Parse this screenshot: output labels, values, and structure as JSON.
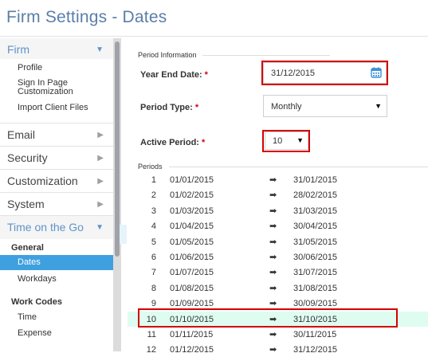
{
  "header": {
    "title": "Firm Settings - Dates"
  },
  "sidebar": {
    "firm": {
      "label": "Firm",
      "items": [
        "Profile",
        "Sign In Page Customization",
        "Import Client Files"
      ]
    },
    "sections": [
      {
        "label": "Email"
      },
      {
        "label": "Security"
      },
      {
        "label": "Customization"
      },
      {
        "label": "System"
      }
    ],
    "time_on_the_go": {
      "label": "Time on the Go",
      "general_heading": "General",
      "general_items": [
        "Dates",
        "Workdays"
      ],
      "active_item": "Dates",
      "work_codes_heading": "Work Codes",
      "work_code_items": [
        "Time",
        "Expense"
      ]
    }
  },
  "main": {
    "period_information_legend": "Period Information",
    "year_end_date": {
      "label": "Year End Date:",
      "required": "*",
      "value": "31/12/2015"
    },
    "period_type": {
      "label": "Period Type:",
      "required": "*",
      "value": "Monthly"
    },
    "active_period": {
      "label": "Active Period:",
      "required": "*",
      "value": "10"
    },
    "periods_legend": "Periods",
    "arrow_glyph": "➡",
    "periods": [
      {
        "num": "1",
        "start": "01/01/2015",
        "end": "31/01/2015"
      },
      {
        "num": "2",
        "start": "01/02/2015",
        "end": "28/02/2015"
      },
      {
        "num": "3",
        "start": "01/03/2015",
        "end": "31/03/2015"
      },
      {
        "num": "4",
        "start": "01/04/2015",
        "end": "30/04/2015"
      },
      {
        "num": "5",
        "start": "01/05/2015",
        "end": "31/05/2015"
      },
      {
        "num": "6",
        "start": "01/06/2015",
        "end": "30/06/2015"
      },
      {
        "num": "7",
        "start": "01/07/2015",
        "end": "31/07/2015"
      },
      {
        "num": "8",
        "start": "01/08/2015",
        "end": "31/08/2015"
      },
      {
        "num": "9",
        "start": "01/09/2015",
        "end": "30/09/2015"
      },
      {
        "num": "10",
        "start": "01/10/2015",
        "end": "31/10/2015"
      },
      {
        "num": "11",
        "start": "01/11/2015",
        "end": "30/11/2015"
      },
      {
        "num": "12",
        "start": "01/12/2015",
        "end": "31/12/2015"
      }
    ],
    "selected_period": "10"
  },
  "colors": {
    "title_blue": "#5a7ea8",
    "expanded_blue": "#5f93c9",
    "active_item_bg": "#3fa0e0",
    "required_red": "#d0021b",
    "highlight_border": "#d40000",
    "selected_row_bg": "#dffcf1",
    "calendar_icon": "#3b8fd9"
  }
}
